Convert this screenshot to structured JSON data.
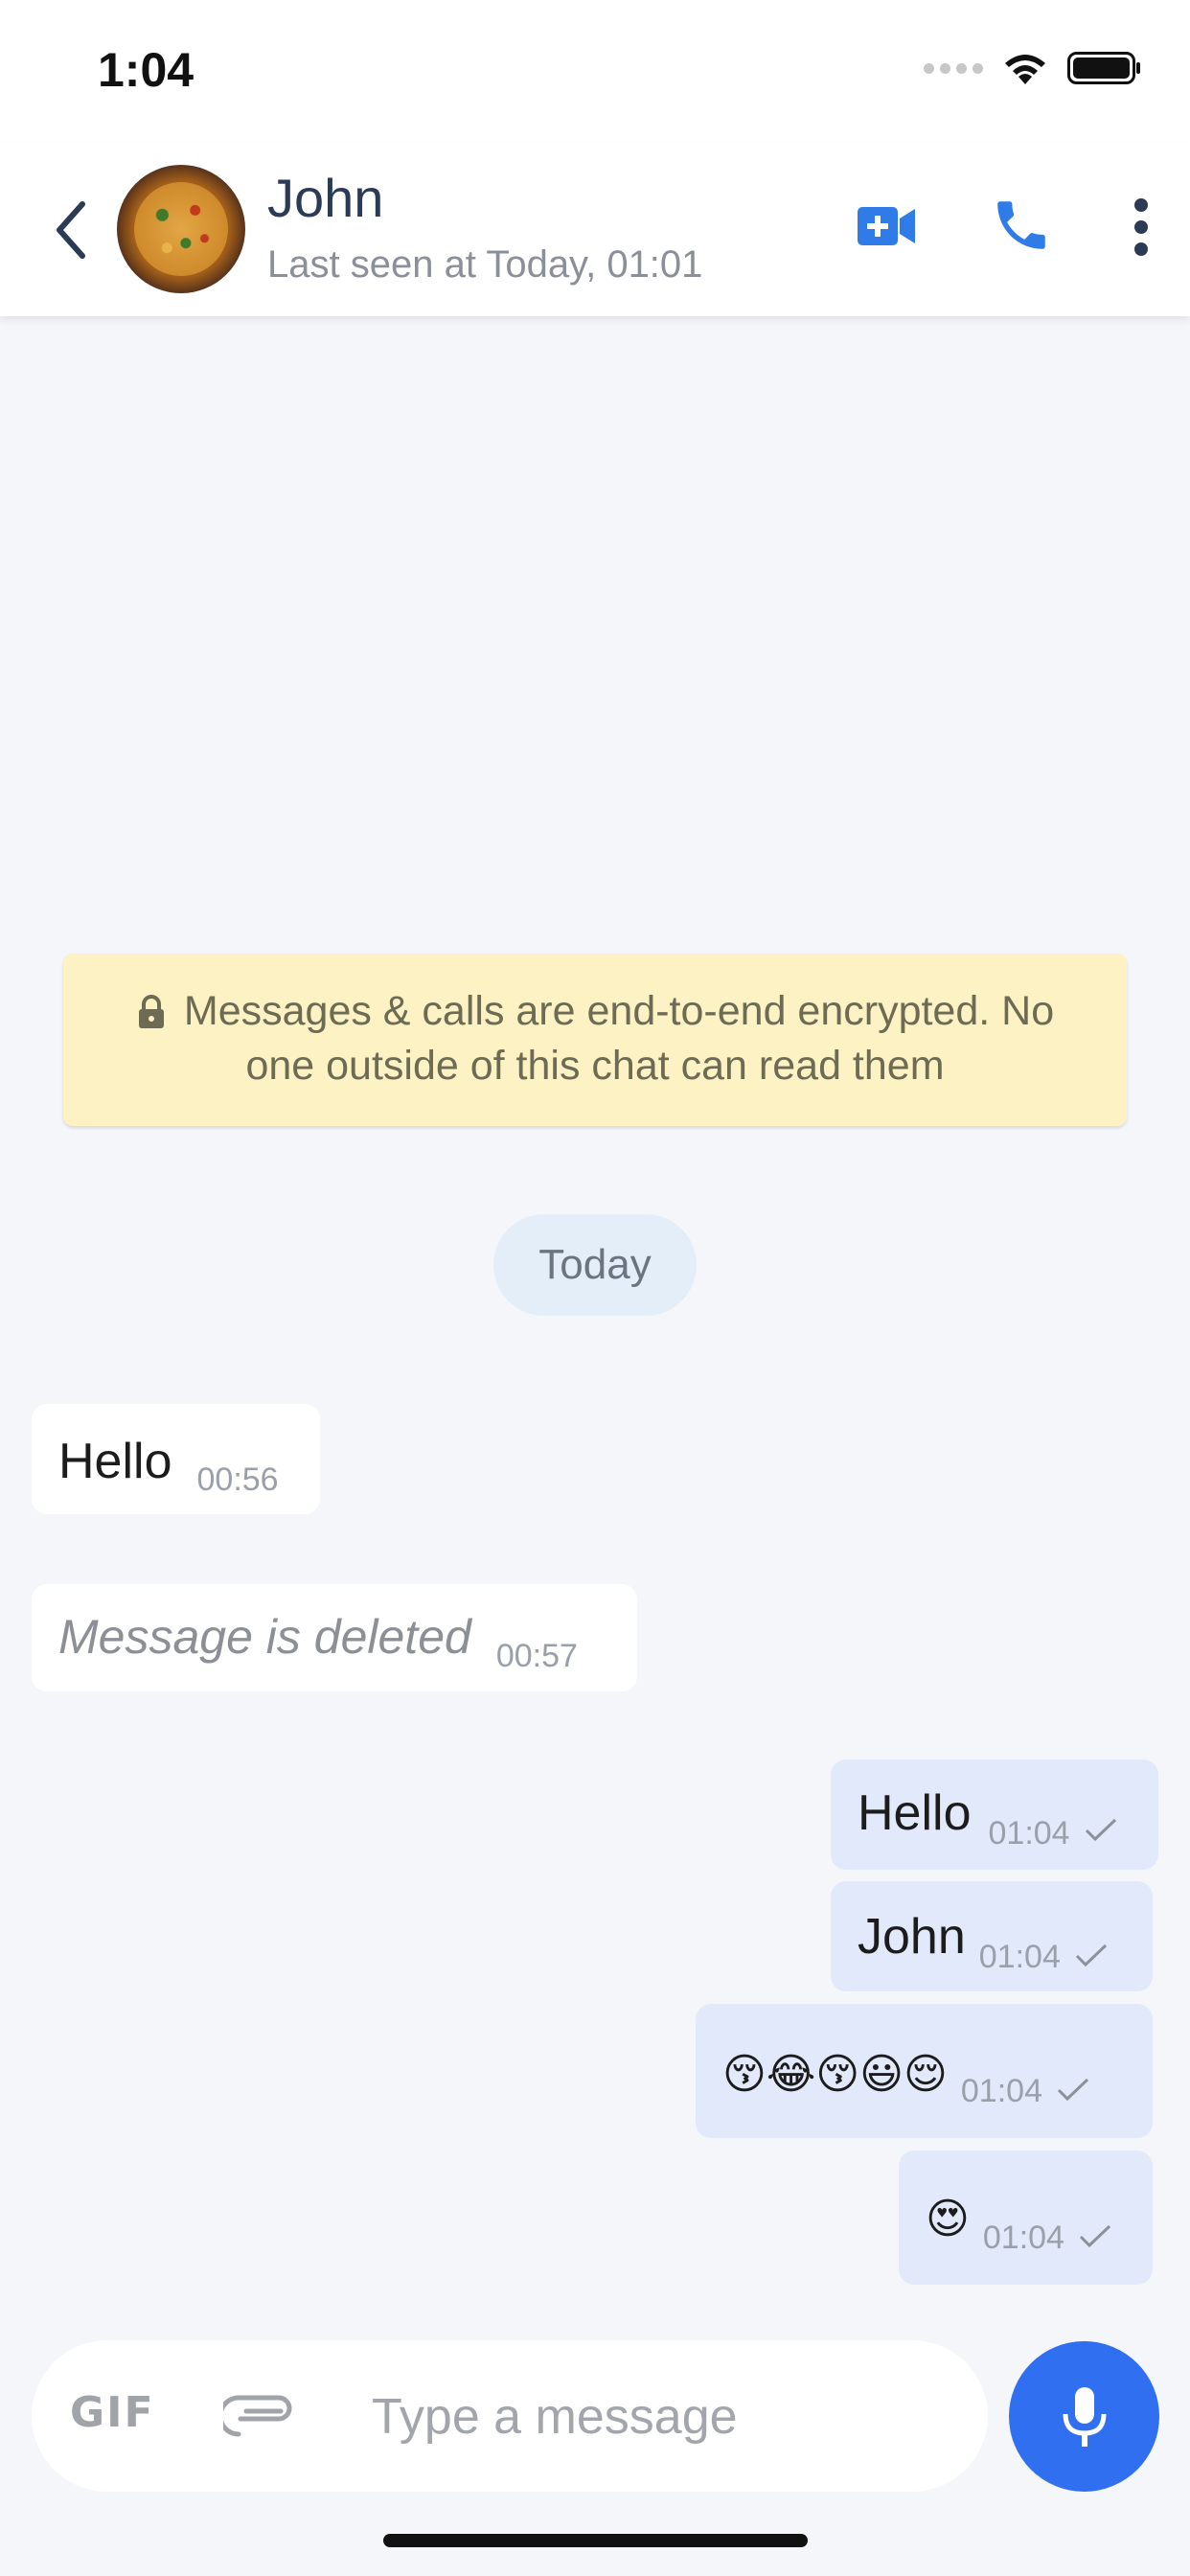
{
  "status_bar": {
    "time": "1:04"
  },
  "header": {
    "contact_name": "John",
    "last_seen": "Last seen at Today, 01:01",
    "icons": [
      "back-icon",
      "video-call-icon",
      "phone-icon",
      "more-vert-icon"
    ]
  },
  "encryption_notice": {
    "line1": "Messages & calls are end-to-end encrypted. No",
    "line2": "one outside of this chat can read them"
  },
  "date_divider": "Today",
  "messages": [
    {
      "direction": "incoming",
      "text": "Hello",
      "time": "00:56"
    },
    {
      "direction": "incoming",
      "text": "Message is deleted",
      "time": "00:57",
      "deleted": true
    },
    {
      "direction": "outgoing",
      "text": "Hello",
      "time": "01:04",
      "status": "sent"
    },
    {
      "direction": "outgoing",
      "text": "John",
      "time": "01:04",
      "status": "sent"
    },
    {
      "direction": "outgoing",
      "text": "😚😂😚😃😌",
      "time": "01:04",
      "status": "sent"
    },
    {
      "direction": "outgoing",
      "text": "😍",
      "time": "01:04",
      "status": "sent"
    }
  ],
  "composer": {
    "gif_label": "GIF",
    "placeholder": "Type a message"
  },
  "colors": {
    "accent": "#2f6ff0",
    "outgoing_bubble": "#e2e9fa",
    "incoming_bubble": "#ffffff",
    "banner": "#fcf2c4"
  }
}
